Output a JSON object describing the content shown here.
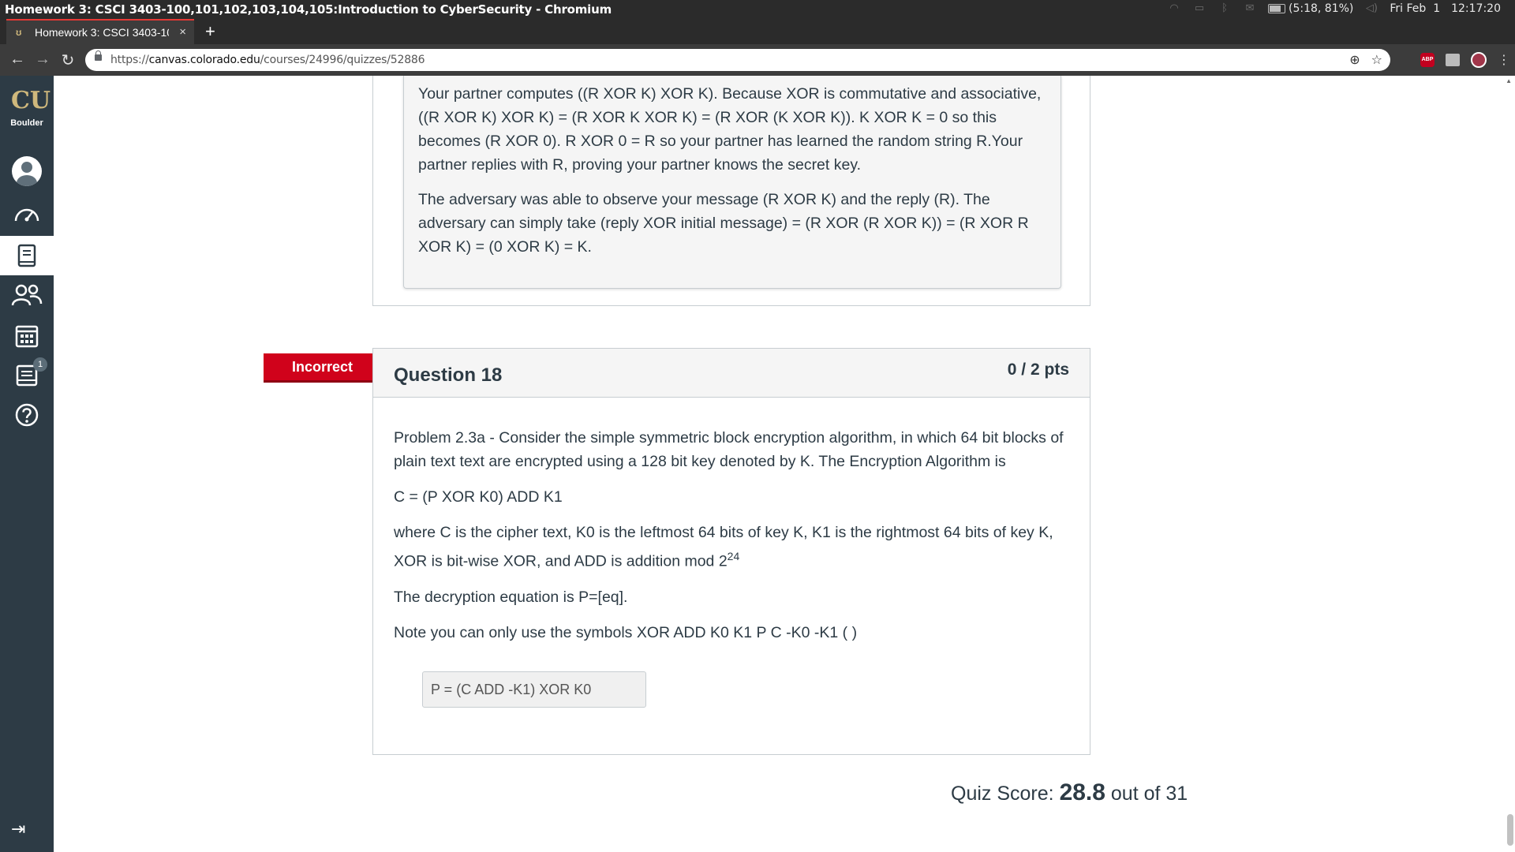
{
  "os": {
    "window_title": "Homework 3: CSCI 3403-100,101,102,103,104,105:Introduction to CyberSecurity - Chromium",
    "battery": "(5:18, 81%)",
    "date": "Fri Feb  1",
    "time": "12:17:20"
  },
  "browser": {
    "tab_title": "Homework 3: CSCI 3403-100,101,102,103,104,105:Introduction to CyberSecurity",
    "new_tab": "+",
    "close": "×",
    "url_prefix": "https://",
    "url_host": "canvas.colorado.edu",
    "url_path": "/courses/24996/quizzes/52886",
    "ext_abp": "ABP"
  },
  "nav": {
    "logo_text": "Boulder",
    "logo_mark": "CU",
    "inbox_badge": "1"
  },
  "prev_question": {
    "comment_p1": "Your partner computes ((R XOR K) XOR K).  Because XOR is commutative and associative, ((R XOR K) XOR K) = (R XOR K XOR K) = (R XOR (K XOR K)).  K XOR K = 0 so this becomes (R XOR 0). R XOR 0 = R so your partner has learned the random string R.Your partner replies with R, proving your partner knows the secret key.",
    "comment_p2": "The adversary was able to observe your message (R XOR K) and the reply (R).  The adversary can simply take (reply XOR initial message) = (R XOR (R XOR K)) = (R XOR R XOR K) = (0 XOR K) = K."
  },
  "question18": {
    "flag": "Incorrect",
    "title": "Question 18",
    "points": "0 / 2 pts",
    "p1": "Problem 2.3a - Consider the simple symmetric block encryption algorithm, in which 64 bit blocks of plain text text are encrypted using a 128 bit key denoted by K.  The Encryption Algorithm is",
    "p2": "C = (P XOR K0) ADD K1",
    "p3_main": "where C is the cipher text, K0 is the leftmost 64 bits of key K, K1 is the rightmost 64 bits of key K, XOR is bit-wise XOR, and ADD is addition mod 2",
    "p3_sup": "24",
    "p4": "The decryption equation is P=[eq].",
    "p5": "Note you can only use the symbols XOR ADD K0 K1 P C -K0 -K1 ( )",
    "answer": "P = (C ADD -K1) XOR K0"
  },
  "score": {
    "label": "Quiz Score:",
    "value": "28.8",
    "suffix": "out of 31"
  }
}
